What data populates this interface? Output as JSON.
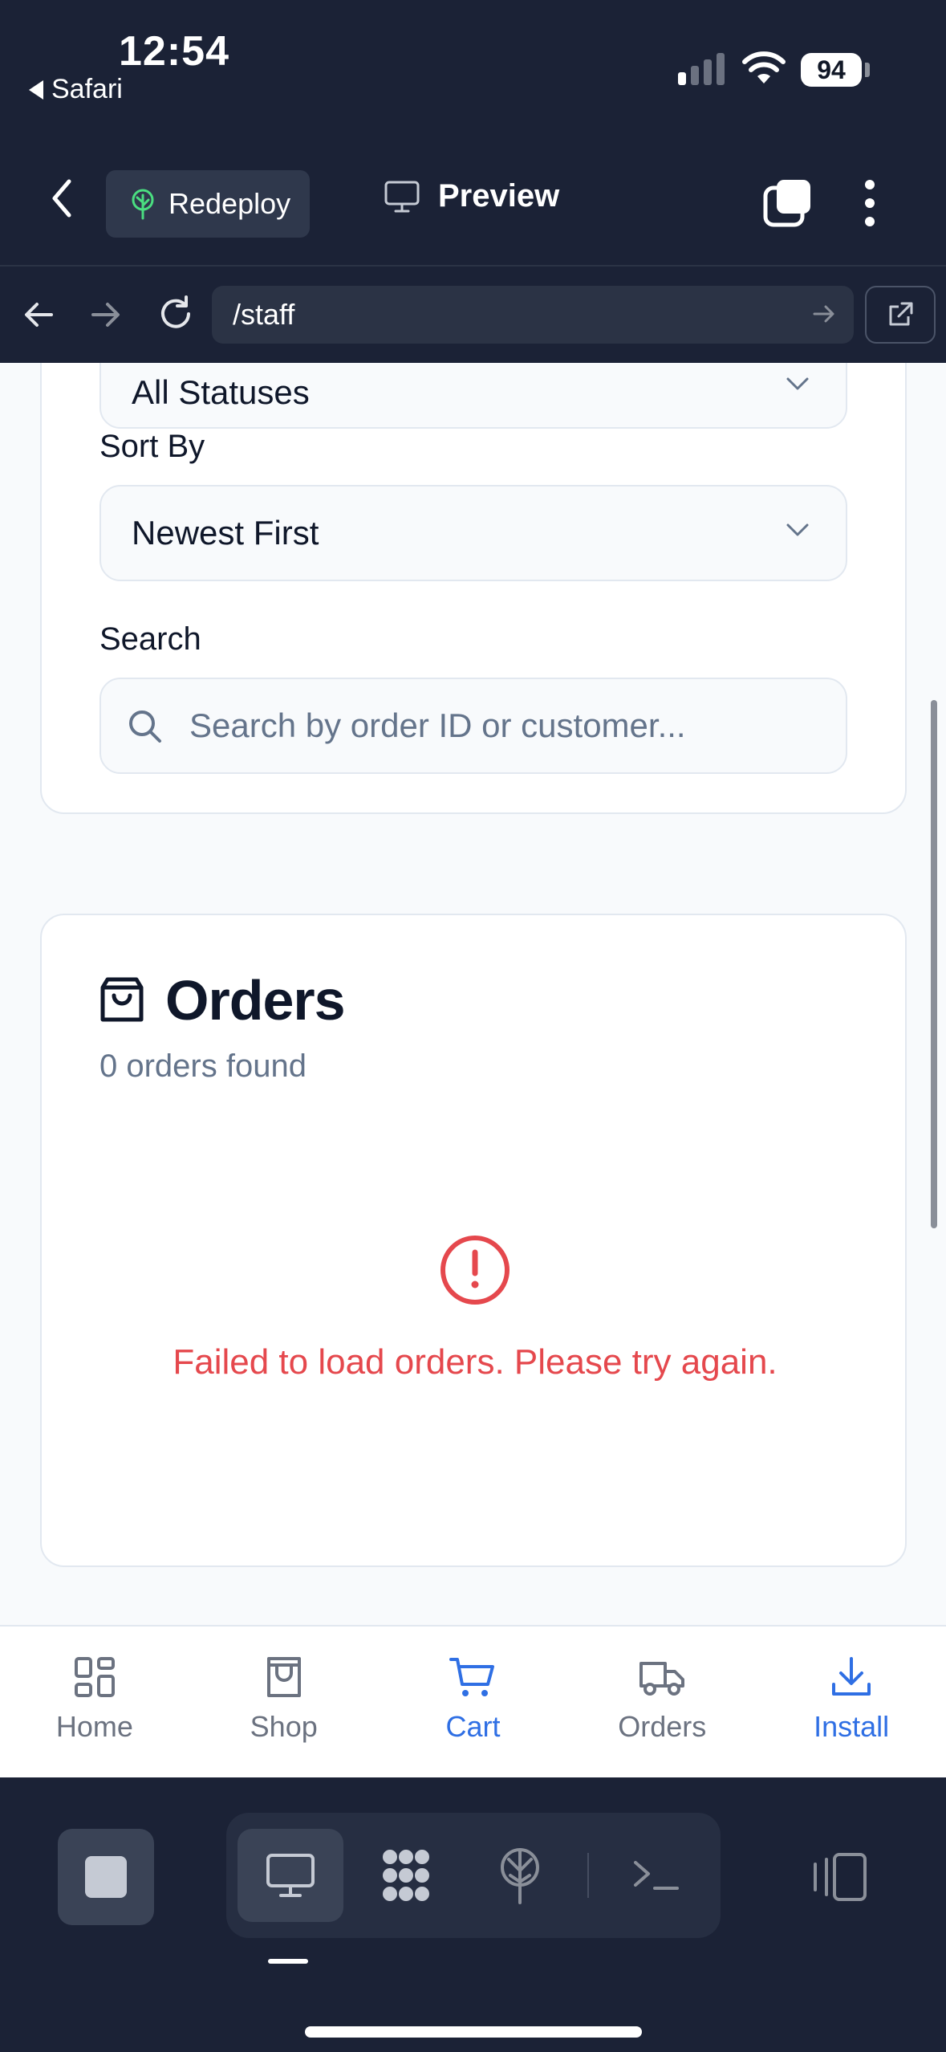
{
  "status_bar": {
    "time": "12:54",
    "back_app": "Safari",
    "battery": "94"
  },
  "header": {
    "redeploy_label": "Redeploy",
    "preview_label": "Preview"
  },
  "browser": {
    "url": "/staff"
  },
  "filters": {
    "status_value": "All Statuses",
    "sort_label": "Sort By",
    "sort_value": "Newest First",
    "search_label": "Search",
    "search_placeholder": "Search by order ID or customer..."
  },
  "orders": {
    "title": "Orders",
    "count_text": "0 orders found",
    "error_text": "Failed to load orders. Please try again."
  },
  "bottom_nav": {
    "items": [
      {
        "label": "Home",
        "icon": "grid-icon",
        "active": false
      },
      {
        "label": "Shop",
        "icon": "shop-bag-icon",
        "active": false
      },
      {
        "label": "Cart",
        "icon": "cart-icon",
        "active": true
      },
      {
        "label": "Orders",
        "icon": "truck-icon",
        "active": false
      },
      {
        "label": "Install",
        "icon": "download-icon",
        "active": true
      }
    ]
  },
  "colors": {
    "accent": "#2f6fe4",
    "error": "#e5484d",
    "dark_chrome": "#1b2236"
  }
}
